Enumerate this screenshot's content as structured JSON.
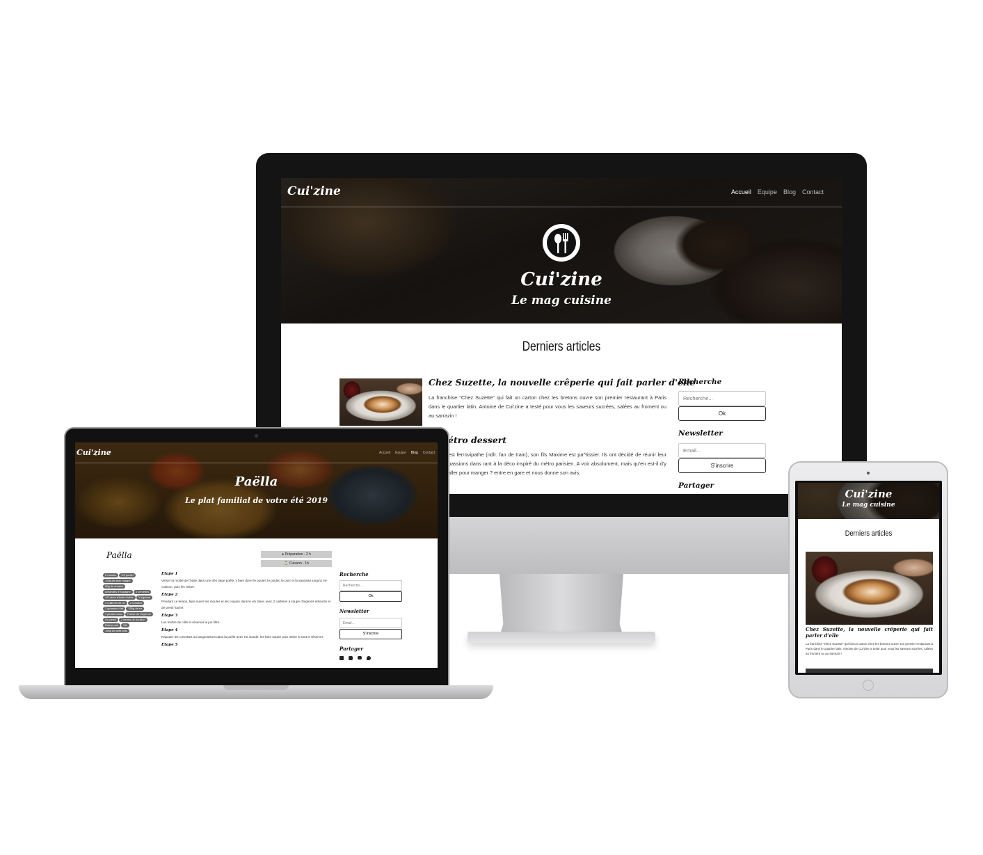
{
  "desktop": {
    "logo": "Cui'zine",
    "nav": [
      "Accueil",
      "Equipe",
      "Blog",
      "Contact"
    ],
    "hero_title": "Cui'zine",
    "hero_subtitle": "Le mag cuisine",
    "section_title": "Derniers articles",
    "articles": [
      {
        "title": "Chez Suzette, la nouvelle crêperie qui fait parler d'elle",
        "excerpt": "La franchise \"Chez Suzette\" qui fait un carton chez les bretons ouvre son premier restaurant à Paris dans le quartier latin. Antoine de Cui'zine a testé pour vous les saveurs sucrées, salées au froment ou au sarrazin !"
      },
      {
        "title": "étro dessert",
        "excerpt": "est ferrovipathe (ndlr. fan de train), son fils Maxime est pa^tissier. Ils ont décidé de réunir leur passions dans rant à la déco inspiré du métro parisien. A voir absolument, mais qu'en est-il d'y aller pour manger ? entre en gare et nous donne son avis."
      }
    ],
    "sidebar": {
      "search_heading": "Recherche",
      "search_placeholder": "Recherche...",
      "search_button": "Ok",
      "newsletter_heading": "Newsletter",
      "email_placeholder": "Email...",
      "subscribe_button": "S'inscrire",
      "share_heading": "Partager"
    }
  },
  "laptop": {
    "logo": "Cui'zine",
    "nav": [
      "Accueil",
      "Equipe",
      "Blog",
      "Contact"
    ],
    "hero_title": "Paëlla",
    "hero_subtitle": "Le plat familial de votre été 2019",
    "recipe_title": "Paëlla",
    "prep": "Préparation - 2 h",
    "cook": "Cuisson - 1h",
    "ingredients": [
      "6 moules",
      "1/2 poulet",
      "125g de porc maigre",
      "60g de chorizo",
      "Amandes d'Espagne",
      "4 crevettes",
      "1/2 verre d'huile d'olive",
      "3 oignons",
      "3 cuillères de riz",
      "2 tomates",
      "2 gousses d'ail",
      "250g de riz",
      "1 piment doux",
      "Poivre de Cayenne",
      "Du persil",
      "2 verres de bouillon",
      "Poivre noir",
      "Sel",
      "125g de petit pois"
    ],
    "steps": [
      {
        "title": "Etape 1",
        "text": "Verser la moitié de l'huile dans une très large poêle, y faire dorer le poulet, le poulet, le porc et la saucisse jusqu'à mi-cuisson, puis les retirer."
      },
      {
        "title": "Etape 2",
        "text": "Pendant ce temps, faire ouvrir les moules et les coques dans le vin blanc avec 2 cuillères à soupe d'oignons émincés et de persil haché."
      },
      {
        "title": "Etape 3",
        "text": "Les mettre de côté et réserver le jus filtré."
      },
      {
        "title": "Etape 4",
        "text": "Rajouter les crevettes ou langoustines dans la poêle avec Ha viande, les faire sauter puis retirer le tout et réserver."
      },
      {
        "title": "Etape 5",
        "text": ""
      }
    ],
    "sidebar": {
      "search_heading": "Recherche",
      "search_placeholder": "Recherche...",
      "search_button": "Ok",
      "newsletter_heading": "Newsletter",
      "email_placeholder": "Email...",
      "subscribe_button": "S'inscrire",
      "share_heading": "Partager"
    }
  },
  "tablet": {
    "hero_title": "Cui'zine",
    "hero_subtitle": "Le mag cuisine",
    "section_title": "Derniers articles",
    "article_title": "Chez Suzette, la nouvelle crêperie qui fait parler d'elle",
    "article_excerpt": "La franchise \"Chez Suzette\" qui fait un carton chez les bretons ouvre son premier restaurant à Paris dans le quartier latin. Antoine de Cui'zine a testé pour vous les saveurs sucrées, salées au froment ou au sarrazin !"
  },
  "colors": {
    "accent": "#111111",
    "device_frame": "#141414",
    "device_silver": "#c9c9cb",
    "hero_overlay": "#1a1714"
  },
  "icons": [
    "spoon-fork-icon",
    "facebook-icon",
    "instagram-icon",
    "youtube-icon",
    "twitter-icon",
    "clock-icon",
    "hourglass-icon"
  ]
}
